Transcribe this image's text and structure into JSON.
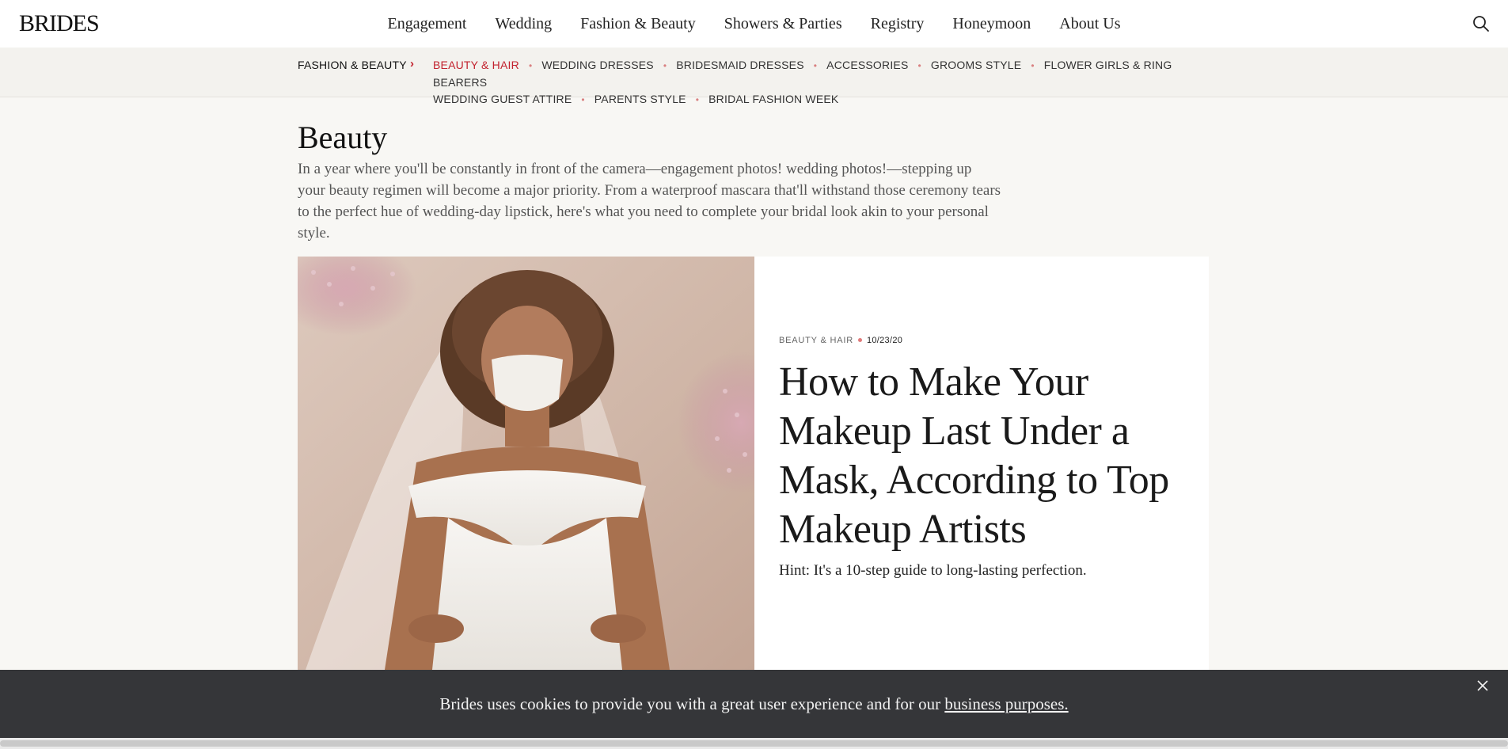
{
  "header": {
    "logo": "BRIDES",
    "nav": [
      "Engagement",
      "Wedding",
      "Fashion & Beauty",
      "Showers & Parties",
      "Registry",
      "Honeymoon",
      "About Us"
    ],
    "search_icon": "search-icon"
  },
  "subnav": {
    "parent": "FASHION & BEAUTY",
    "items": [
      "BEAUTY & HAIR",
      "WEDDING DRESSES",
      "BRIDESMAID DRESSES",
      "ACCESSORIES",
      "GROOMS STYLE",
      "FLOWER GIRLS & RING BEARERS",
      "WEDDING GUEST ATTIRE",
      "PARENTS STYLE",
      "BRIDAL FASHION WEEK"
    ],
    "active_color": "#c2222e"
  },
  "intro": {
    "title": "Beauty",
    "description": "In a year where you'll be constantly in front of the camera—engagement photos! wedding photos!—stepping up your beauty regimen will become a major priority. From a waterproof mascara that'll withstand those ceremony tears to the perfect hue of wedding-day lipstick, here's what you need to complete your bridal look akin to your personal style."
  },
  "feature": {
    "category": "BEAUTY & HAIR",
    "date": "10/23/20",
    "headline": "How to Make Your Makeup Last Under a Mask, According to Top Makeup Artists",
    "dek": "Hint: It's a 10-step guide to long-lasting perfection."
  },
  "cookie": {
    "text": "Brides uses cookies to provide you with a great user experience and for our ",
    "link": "business purposes."
  }
}
